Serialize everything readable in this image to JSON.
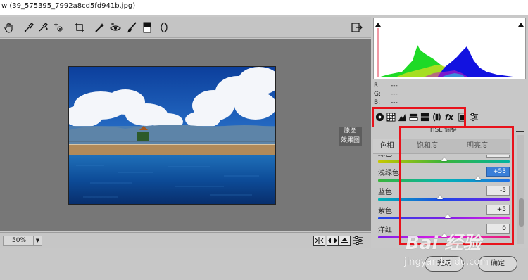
{
  "window": {
    "title": "w (39_575395_7992a8cd5fd941b.jpg)"
  },
  "toolbar": {
    "tools": [
      "hand-icon",
      "eyedropper-icon",
      "color-sampler-icon",
      "target-adjust-icon",
      "crop-icon",
      "spot-removal-icon",
      "red-eye-icon",
      "adjustment-brush-icon",
      "graduated-filter-icon",
      "radial-filter-icon"
    ],
    "export_icon": "open-image-icon"
  },
  "preview": {
    "tab_original": "原图",
    "tab_effect": "效果图"
  },
  "bottom": {
    "zoom": "50%",
    "icons": [
      "before-after-icon",
      "swap-icon",
      "copy-settings-icon",
      "toggle-settings-icon"
    ]
  },
  "buttons": {
    "done": "完成",
    "ok": "确定"
  },
  "readout": {
    "r_label": "R:",
    "r_value": "---",
    "g_label": "G:",
    "g_value": "---",
    "b_label": "B:",
    "b_value": "---"
  },
  "panel": {
    "tab_icons": [
      "basic-icon",
      "tone-curve-icon",
      "detail-icon",
      "hsl-icon",
      "split-toning-icon",
      "lens-icon",
      "effects-icon",
      "camera-calibration-icon",
      "presets-icon"
    ],
    "fx_label": "fx",
    "title": "HSL 调整",
    "subtabs": [
      "色相",
      "饱和度",
      "明亮度"
    ],
    "active_subtab": 0
  },
  "sliders": [
    {
      "label": "绿色",
      "value": "0",
      "position": 0.5,
      "gradient": "linear-gradient(90deg,#c8c800,#3ab43a,#00b4a0)",
      "selected": false
    },
    {
      "label": "浅绿色",
      "value": "+53",
      "position": 0.76,
      "gradient": "linear-gradient(90deg,#3ab43a,#00b4b4,#1e6ee6)",
      "selected": true
    },
    {
      "label": "蓝色",
      "value": "-5",
      "position": 0.47,
      "gradient": "linear-gradient(90deg,#00b4b4,#1e46e6,#7a1ee6)",
      "selected": false
    },
    {
      "label": "紫色",
      "value": "+5",
      "position": 0.53,
      "gradient": "linear-gradient(90deg,#1e46e6,#7a1ee6,#e61ee6)",
      "selected": false
    },
    {
      "label": "洋红",
      "value": "0",
      "position": 0.5,
      "gradient": "linear-gradient(90deg,#7a1ee6,#e61ee6,#e61e6e)",
      "selected": false
    }
  ],
  "watermark": {
    "logo": "Bai 经验",
    "url": "jingyan.baidu.com"
  },
  "colors": {
    "highlight": "#e8121b",
    "canvas": "#777777",
    "selected_field": "#3b7fd8"
  }
}
